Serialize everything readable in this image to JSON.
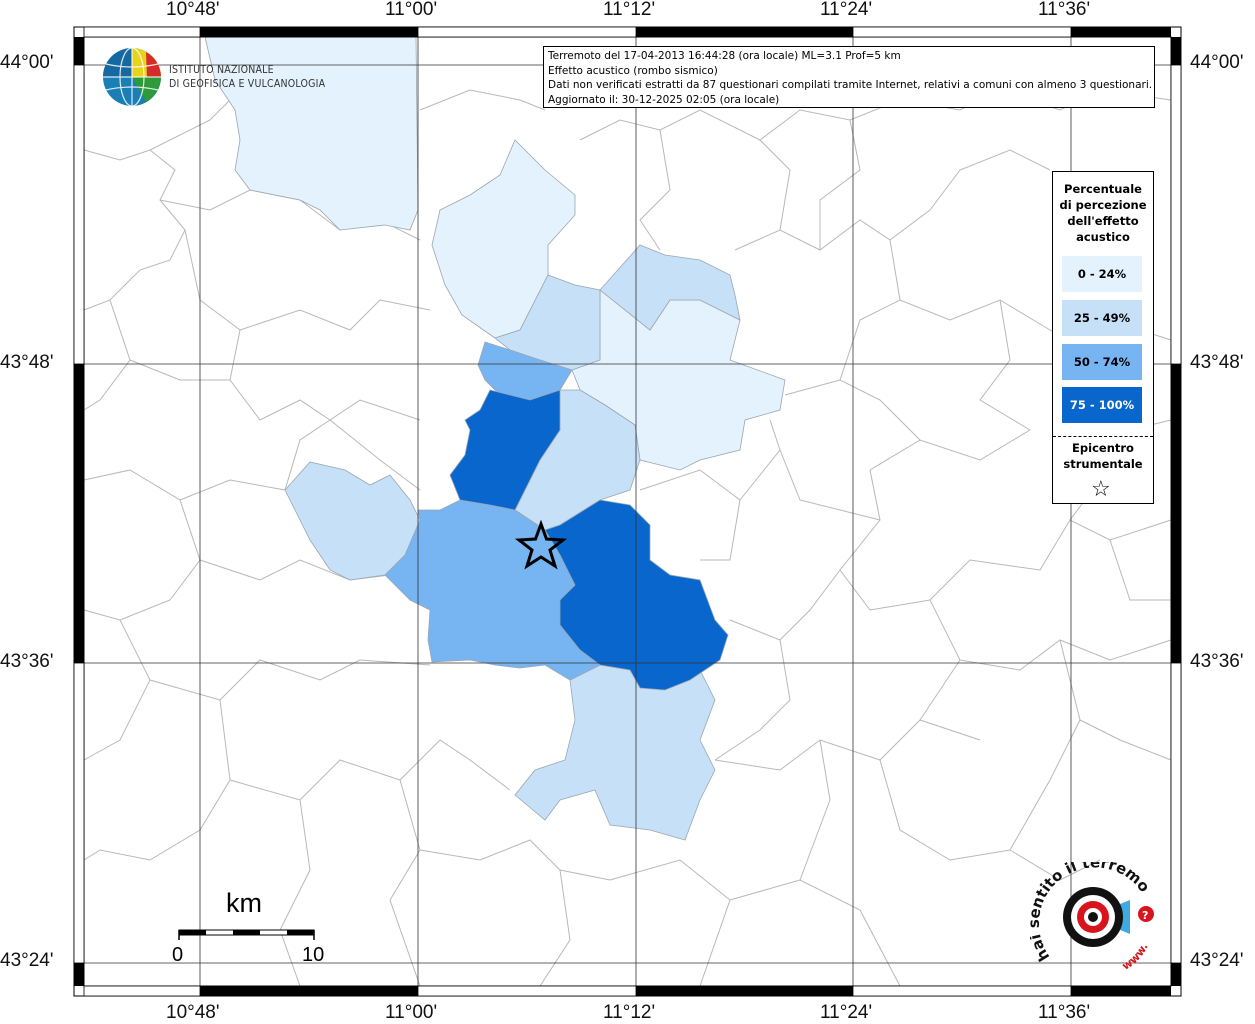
{
  "info": {
    "line1": "Terremoto del 17-04-2013 16:44:28 (ora locale) ML=3.1 Prof=5 km",
    "line2": "Effetto acustico (rombo sismico)",
    "line3": "Dati non verificati estratti da 87 questionari compilati tramite Internet, relativi a comuni con almeno 3 questionari.",
    "line4": "Aggiornato il: 30-12-2025 02:05 (ora locale)"
  },
  "ingv": {
    "line1": "ISTITUTO NAZIONALE",
    "line2": "DI GEOFISICA E VULCANOLOGIA"
  },
  "axes": {
    "lon_labels": [
      "10°48'",
      "11°00'",
      "11°12'",
      "11°24'",
      "11°36'"
    ],
    "lat_labels": [
      "44°00'",
      "43°48'",
      "43°36'",
      "43°24'"
    ]
  },
  "legend": {
    "title_lines": [
      "Percentuale",
      "di percezione",
      "dell'effetto",
      "acustico"
    ],
    "classes": [
      {
        "label": "0 - 24%",
        "color": "#e3f2fc",
        "text_color": "#000000"
      },
      {
        "label": "25 - 49%",
        "color": "#c6e0f7",
        "text_color": "#000000"
      },
      {
        "label": "50 - 74%",
        "color": "#77b4f2",
        "text_color": "#000000"
      },
      {
        "label": "75 - 100%",
        "color": "#0866cc",
        "text_color": "#ffffff"
      }
    ],
    "epicenter_lines": [
      "Epicentro",
      "strumentale"
    ],
    "star_symbol": "☆"
  },
  "scalebar": {
    "unit": "km",
    "min_label": "0",
    "max_label": "10"
  },
  "hst": {
    "text": "hai sentito il terremoto.it",
    "www": "www.",
    "accent_color": "#d8141c"
  },
  "map": {
    "epicenter_symbol": "star",
    "municipalities": [
      {
        "class": 0
      },
      {
        "class": 0
      },
      {
        "class": 0
      },
      {
        "class": 1
      },
      {
        "class": 1
      },
      {
        "class": 1
      },
      {
        "class": 1
      },
      {
        "class": 1
      },
      {
        "class": 2
      },
      {
        "class": 2
      },
      {
        "class": 3
      },
      {
        "class": 3
      }
    ]
  }
}
